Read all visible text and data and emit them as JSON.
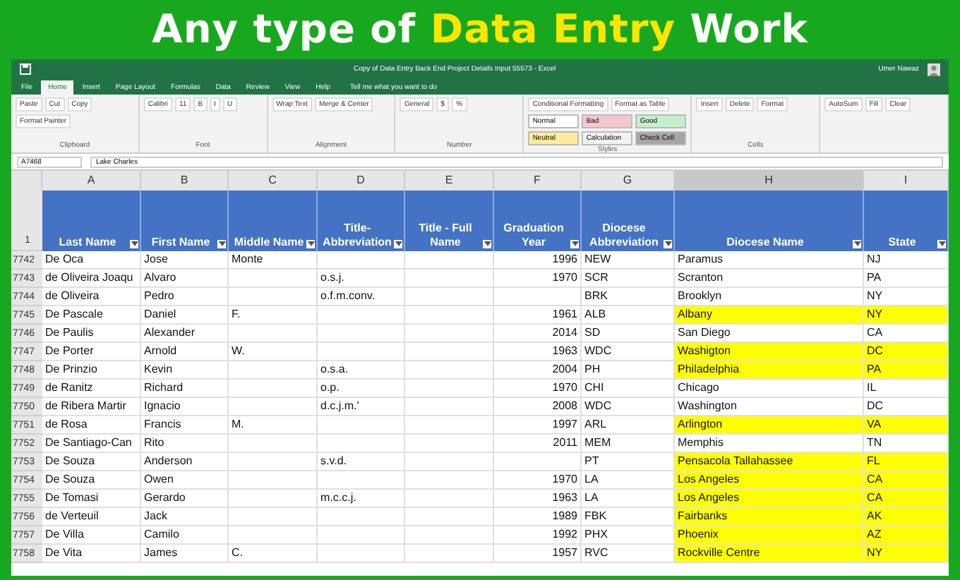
{
  "banner": {
    "parts": [
      {
        "text": "Any type of",
        "highlight": false
      },
      {
        "text": "Data Entry",
        "highlight": true
      },
      {
        "text": "Work",
        "highlight": false
      }
    ]
  },
  "excel": {
    "title": "Copy of Data Entry Back End Project Details Input 55573 - Excel",
    "user": "Umer Nawaz",
    "tabs": [
      {
        "label": "File",
        "selected": false
      },
      {
        "label": "Home",
        "selected": true
      },
      {
        "label": "Insert",
        "selected": false
      },
      {
        "label": "Page Layout",
        "selected": false
      },
      {
        "label": "Formulas",
        "selected": false
      },
      {
        "label": "Data",
        "selected": false
      },
      {
        "label": "Review",
        "selected": false
      },
      {
        "label": "View",
        "selected": false
      },
      {
        "label": "Help",
        "selected": false
      }
    ],
    "tell_me": "Tell me what you want to do",
    "ribbon": [
      {
        "label": "Clipboard",
        "items": [
          "Paste",
          "Cut",
          "Copy",
          "Format Painter"
        ]
      },
      {
        "label": "Font",
        "items": [
          "Calibri",
          "11",
          "B",
          "I",
          "U"
        ]
      },
      {
        "label": "Alignment",
        "items": [
          "Wrap Text",
          "Merge & Center"
        ]
      },
      {
        "label": "Number",
        "items": [
          "General",
          "$",
          "%"
        ]
      },
      {
        "label": "Styles",
        "items": [
          "Conditional Formatting",
          "Format as Table"
        ],
        "styles": [
          {
            "label": "Normal",
            "color": "#ffffff"
          },
          {
            "label": "Bad",
            "color": "#f4c7ce"
          },
          {
            "label": "Good",
            "color": "#c6efce"
          },
          {
            "label": "Neutral",
            "color": "#ffeb9c"
          },
          {
            "label": "Calculation",
            "color": "#f2f2f2"
          },
          {
            "label": "Check Cell",
            "color": "#a5a5a5"
          }
        ]
      },
      {
        "label": "Cells",
        "items": [
          "Insert",
          "Delete",
          "Format"
        ]
      },
      {
        "items": [
          "AutoSum",
          "Fill",
          "Clear"
        ]
      }
    ],
    "name_box": "A7468",
    "formula": "Lake Charles"
  },
  "sheet": {
    "columns": [
      {
        "label": "A",
        "selected": false
      },
      {
        "label": "B",
        "selected": false
      },
      {
        "label": "C",
        "selected": false
      },
      {
        "label": "D",
        "selected": false
      },
      {
        "label": "E",
        "selected": false
      },
      {
        "label": "F",
        "selected": false
      },
      {
        "label": "G",
        "selected": false
      },
      {
        "label": "H",
        "selected": true
      },
      {
        "label": "I",
        "selected": false
      }
    ],
    "header_row": "1",
    "headers": [
      "Last Name",
      "First Name",
      "Middle Name",
      "Title-Abbreviation",
      "Title - Full Name",
      "Graduation Year",
      "Diocese Abbreviation",
      "Diocese Name",
      "State"
    ],
    "rows": [
      {
        "num": "7742",
        "cells": [
          "De Oca",
          "Jose",
          "Monte",
          "",
          "",
          "1996",
          "NEW",
          "Paramus",
          "NJ"
        ],
        "highlighted": false
      },
      {
        "num": "7743",
        "cells": [
          "de Oliveira Joaqu",
          "Alvaro",
          "",
          "o.s.j.",
          "",
          "1970",
          "SCR",
          "Scranton",
          "PA"
        ],
        "highlighted": false
      },
      {
        "num": "7744",
        "cells": [
          "de Oliveira",
          "Pedro",
          "",
          "o.f.m.conv.",
          "",
          "",
          "BRK",
          "Brooklyn",
          "NY"
        ],
        "highlighted": false
      },
      {
        "num": "7745",
        "cells": [
          "De Pascale",
          "Daniel",
          "F.",
          "",
          "",
          "1961",
          "ALB",
          "Albany",
          "NY"
        ],
        "highlighted": true
      },
      {
        "num": "7746",
        "cells": [
          "De Paulis",
          "Alexander",
          "",
          "",
          "",
          "2014",
          "SD",
          " San Diego",
          "CA"
        ],
        "highlighted": false
      },
      {
        "num": "7747",
        "cells": [
          "De Porter",
          "Arnold",
          "W.",
          "",
          "",
          "1963",
          "WDC",
          "Washigton",
          "DC"
        ],
        "highlighted": true
      },
      {
        "num": "7748",
        "cells": [
          "De Prinzio",
          "Kevin",
          "",
          "o.s.a.",
          "",
          "2004",
          "PH",
          "Philadelphia",
          "PA"
        ],
        "highlighted": true
      },
      {
        "num": "7749",
        "cells": [
          "de Ranitz",
          "Richard",
          "",
          "o.p.",
          "",
          "1970",
          "CHI",
          "Chicago",
          "IL"
        ],
        "highlighted": false
      },
      {
        "num": "7750",
        "cells": [
          "de Ribera Martir",
          "Ignacio",
          "",
          "d.c.j.m.'",
          "",
          "2008",
          "WDC",
          "Washington",
          "DC"
        ],
        "highlighted": false
      },
      {
        "num": "7751",
        "cells": [
          "de Rosa",
          "Francis",
          "M.",
          "",
          "",
          "1997",
          "ARL",
          "Arlington",
          "VA"
        ],
        "highlighted": true
      },
      {
        "num": "7752",
        "cells": [
          "De Santiago-Can",
          "Rito",
          "",
          "",
          "",
          "2011",
          "MEM",
          "Memphis",
          "TN"
        ],
        "highlighted": false
      },
      {
        "num": "7753",
        "cells": [
          "De Souza",
          "Anderson",
          "",
          "s.v.d.",
          "",
          "",
          "PT",
          "Pensacola Tallahassee",
          "FL"
        ],
        "highlighted": true
      },
      {
        "num": "7754",
        "cells": [
          "De Souza",
          "Owen",
          "",
          "",
          "",
          "1970",
          "LA",
          "Los Angeles",
          "CA"
        ],
        "highlighted": true
      },
      {
        "num": "7755",
        "cells": [
          "De Tomasi",
          "Gerardo",
          "",
          "m.c.c.j.",
          "",
          "1963",
          "LA",
          "Los Angeles",
          "CA"
        ],
        "highlighted": true
      },
      {
        "num": "7756",
        "cells": [
          "de Verteuil",
          "Jack",
          "",
          "",
          "",
          "1989",
          "FBK",
          "Fairbanks",
          "AK"
        ],
        "highlighted": true
      },
      {
        "num": "7757",
        "cells": [
          "De Villa",
          "Camilo",
          "",
          "",
          "",
          "1992",
          "PHX",
          "Phoenix",
          "AZ"
        ],
        "highlighted": true
      },
      {
        "num": "7758",
        "cells": [
          "De Vita",
          "James",
          "C.",
          "",
          "",
          "1957",
          "RVC",
          "Rockville Centre",
          "NY"
        ],
        "highlighted": true
      }
    ]
  }
}
